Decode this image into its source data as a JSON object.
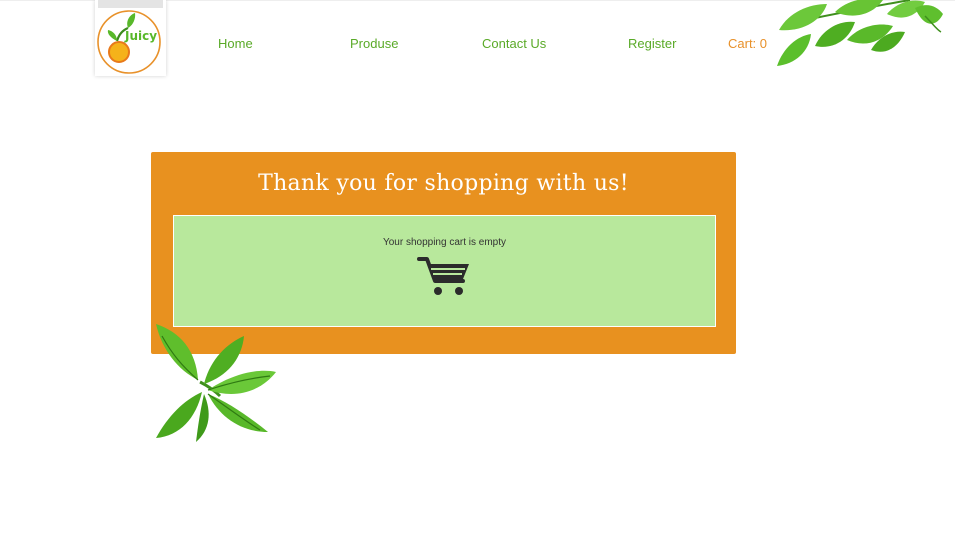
{
  "header": {
    "logo_text": "Juicy",
    "nav": [
      {
        "label": "Home"
      },
      {
        "label": "Produse"
      },
      {
        "label": "Contact Us"
      },
      {
        "label": "Register"
      }
    ],
    "cart_label": "Cart: 0"
  },
  "panel": {
    "title": "Thank you for shopping with us!",
    "empty_message": "Your shopping cart is empty",
    "icon": "shopping-cart-icon"
  },
  "colors": {
    "nav_text": "#5aaa28",
    "cart_text": "#e8912a",
    "panel_background": "#e8911f",
    "cart_box_background": "#b8e89c",
    "leaf_green": "#58b82a"
  }
}
